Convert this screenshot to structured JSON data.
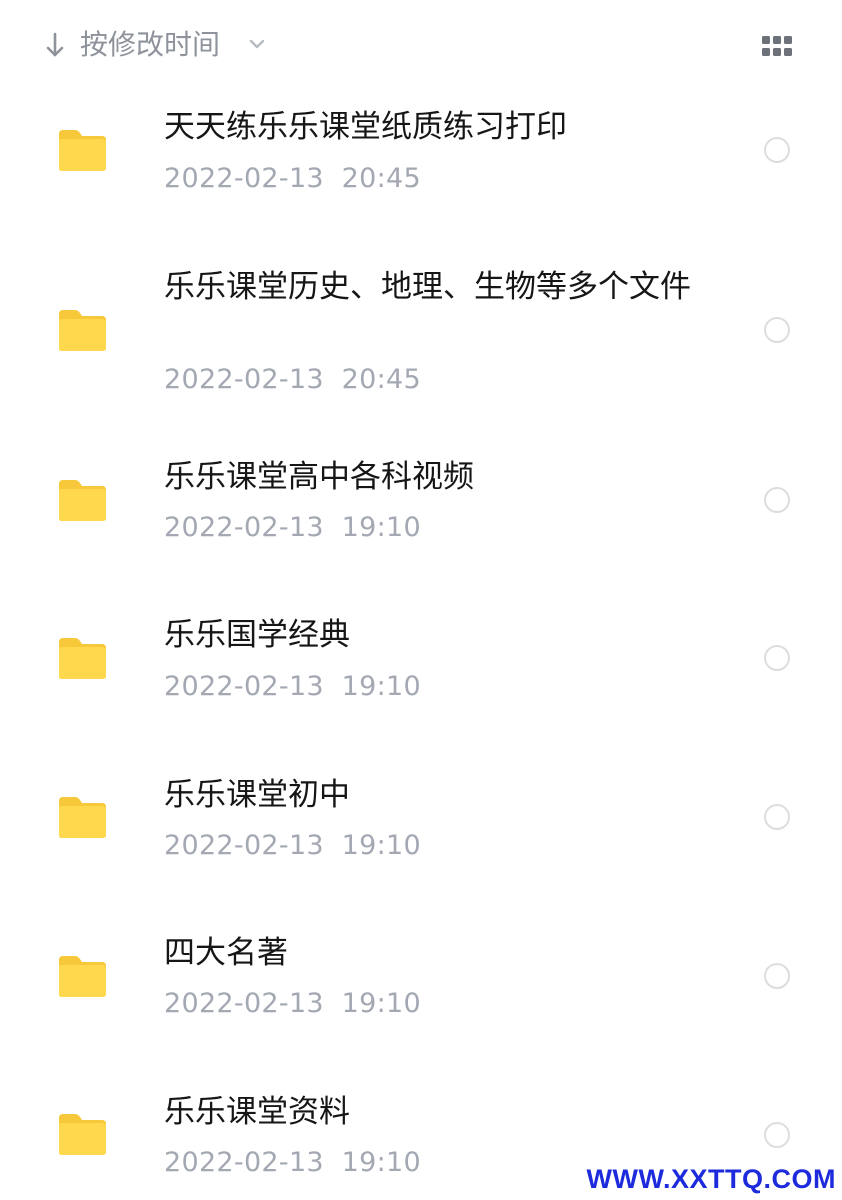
{
  "sort": {
    "label": "按修改时间",
    "direction_icon": "arrow-down-icon",
    "dropdown_icon": "chevron-down-icon"
  },
  "view_toggle_icon": "grid-view-icon",
  "colors": {
    "folder": "#FFD84E",
    "folder_tab": "#F7C93A",
    "text_primary": "#161616",
    "text_secondary": "#A3A8B2",
    "radio_border": "#DCDDE0",
    "watermark": "#1D2BDC"
  },
  "files": [
    {
      "name": "天天练乐乐课堂纸质练习打印",
      "date": "2022-02-13  20:45",
      "icon": "folder-icon"
    },
    {
      "name": "乐乐课堂历史、地理、生物等多个文件",
      "date": "2022-02-13  20:45",
      "icon": "folder-icon"
    },
    {
      "name": "乐乐课堂高中各科视频",
      "date": "2022-02-13  19:10",
      "icon": "folder-icon"
    },
    {
      "name": "乐乐国学经典",
      "date": "2022-02-13  19:10",
      "icon": "folder-icon"
    },
    {
      "name": "乐乐课堂初中",
      "date": "2022-02-13  19:10",
      "icon": "folder-icon"
    },
    {
      "name": "四大名著",
      "date": "2022-02-13  19:10",
      "icon": "folder-icon"
    },
    {
      "name": "乐乐课堂资料",
      "date": "2022-02-13  19:10",
      "icon": "folder-icon"
    }
  ],
  "watermark": "WWW.XXTTQ.COM"
}
